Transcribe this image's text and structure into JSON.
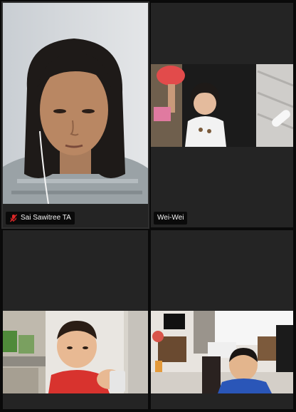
{
  "participants": [
    {
      "name": "Sai Sawitree TA",
      "muted": true
    },
    {
      "name": "Wei-Wei",
      "muted": false
    },
    {
      "name": "",
      "muted": false
    },
    {
      "name": "",
      "muted": false
    }
  ],
  "colors": {
    "background": "#0a0a0a",
    "tile": "#242424",
    "label_bg": "#000000",
    "muted_icon": "#e02828"
  },
  "icons": {
    "muted": "microphone-muted-icon"
  }
}
